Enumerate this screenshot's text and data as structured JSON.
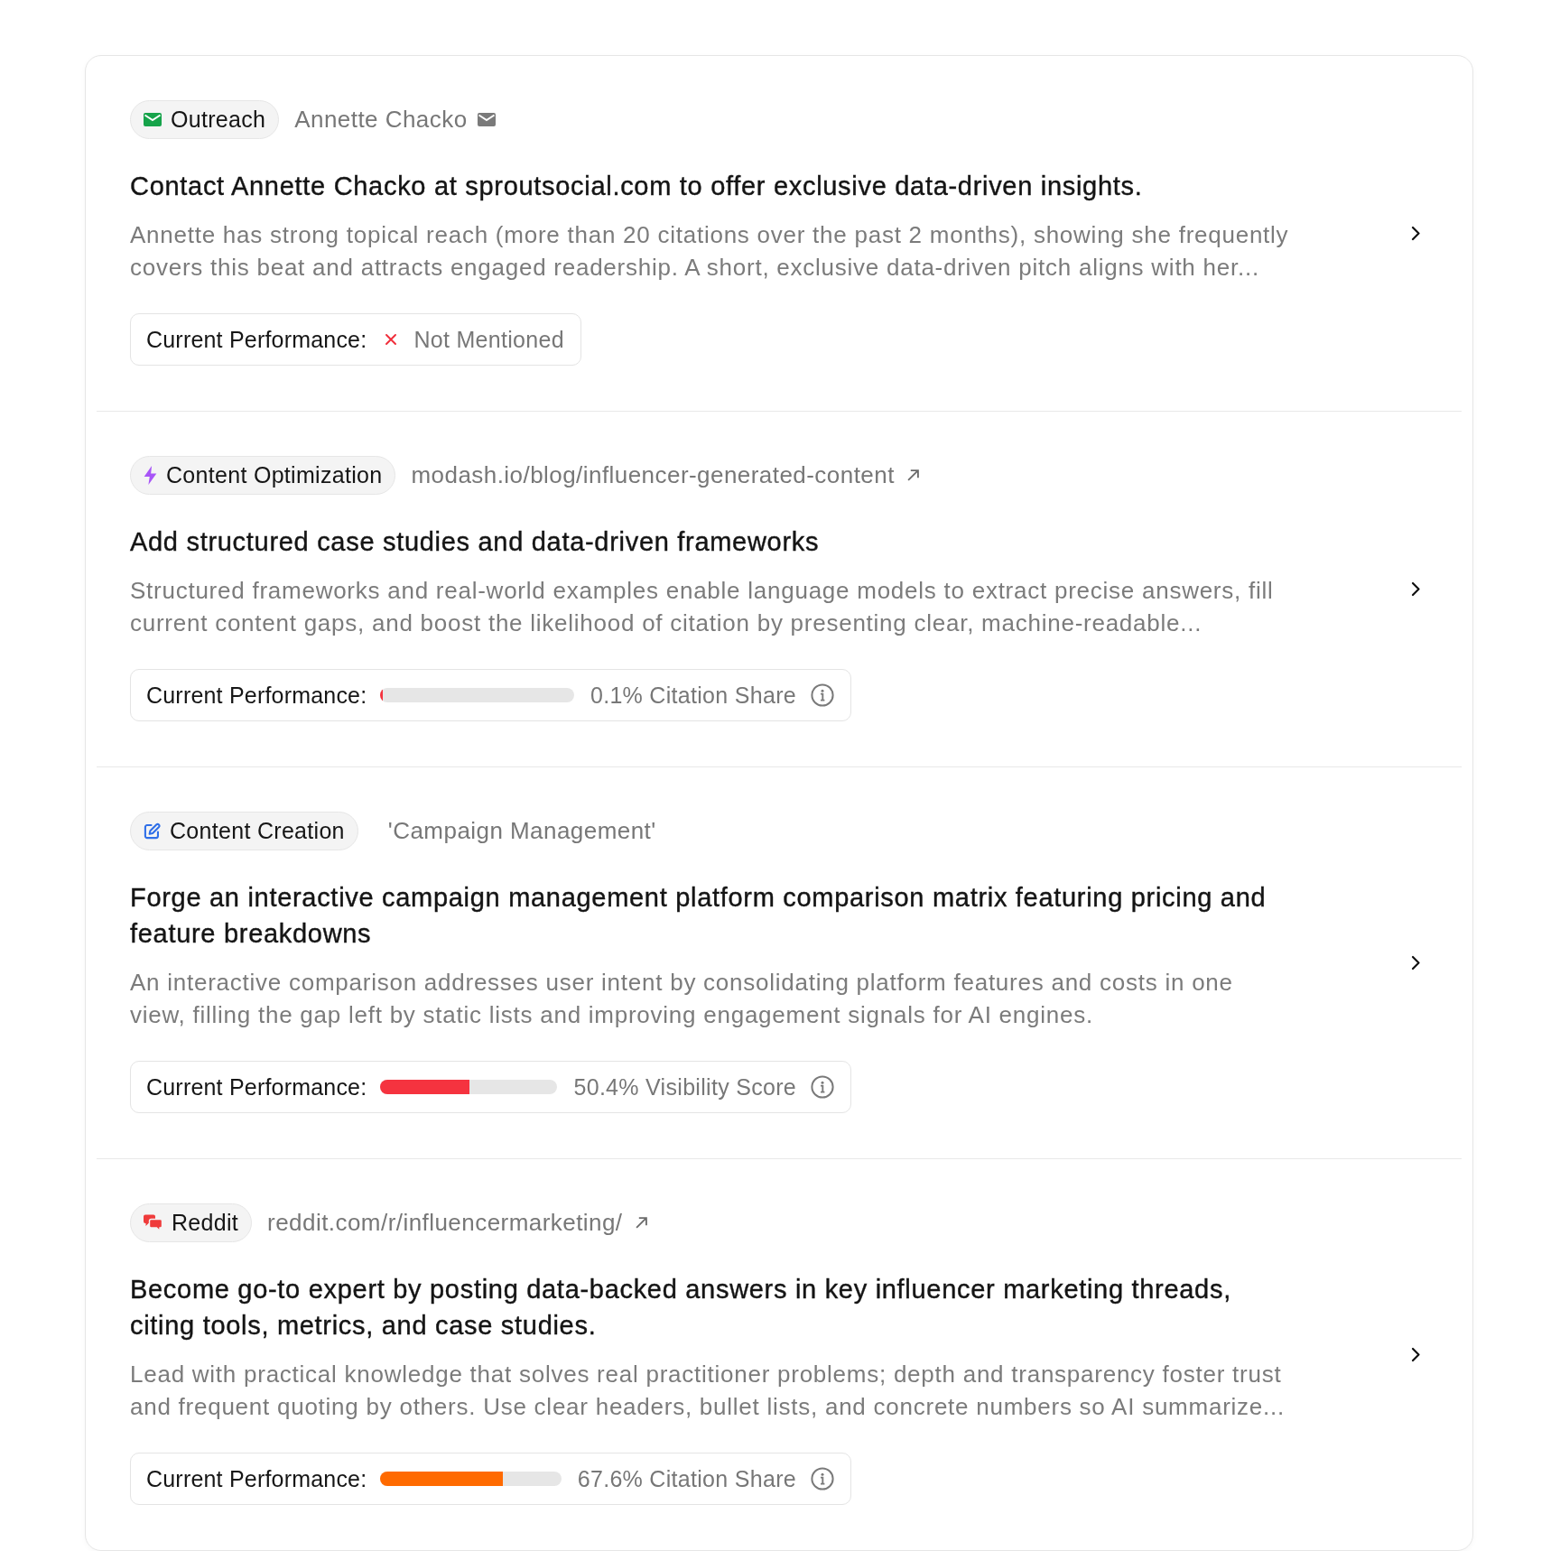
{
  "items": [
    {
      "category": {
        "kind": "outreach",
        "label": "Outreach"
      },
      "target": {
        "kind": "contact",
        "text": "Annette Chacko"
      },
      "title": "Contact Annette Chacko at sproutsocial.com to offer exclusive data-driven insights.",
      "description": "Annette has strong topical reach (more than 20 citations over the past 2 months), showing she frequently covers this beat and attracts engaged readership. A short, exclusive data-driven pitch aligns with her...",
      "performance": {
        "kind": "status",
        "label": "Current Performance:",
        "status": "Not Mentioned"
      }
    },
    {
      "category": {
        "kind": "optimization",
        "label": "Content Optimization"
      },
      "target": {
        "kind": "link",
        "text": "modash.io/blog/influencer-generated-content"
      },
      "title": "Add structured case studies and data-driven frameworks",
      "description": "Structured frameworks and real-world examples enable language models to extract precise answers, fill current content gaps, and boost the likelihood of citation by presenting clear, machine-readable...",
      "performance": {
        "kind": "bar",
        "label": "Current Performance:",
        "level": 0.001,
        "color": "#f5333f",
        "reading": "0.1% Citation Share"
      }
    },
    {
      "category": {
        "kind": "creation",
        "label": "Content Creation"
      },
      "target": {
        "kind": "keyword",
        "text": "'Campaign Management'"
      },
      "title": "Forge an interactive campaign management platform comparison matrix featuring pricing and feature breakdowns",
      "description": "An interactive comparison addresses user intent by consolidating platform features and costs in one view, filling the gap left by static lists and improving engagement signals for AI engines.",
      "performance": {
        "kind": "bar",
        "label": "Current Performance:",
        "level": 0.504,
        "color": "#f5333f",
        "reading": "50.4% Visibility Score"
      }
    },
    {
      "category": {
        "kind": "reddit",
        "label": "Reddit"
      },
      "target": {
        "kind": "link",
        "text": "reddit.com/r/influencermarketing/"
      },
      "title": "Become go-to expert by posting data-backed answers in key influencer marketing threads, citing tools, metrics, and case studies.",
      "description": "Lead with practical knowledge that solves real practitioner problems; depth and transparency foster trust and frequent quoting by others. Use clear headers, bullet lists, and concrete numbers so AI summarize...",
      "performance": {
        "kind": "bar",
        "label": "Current Performance:",
        "level": 0.676,
        "color": "#ff6a00",
        "reading": "67.6% Citation Share"
      }
    }
  ]
}
